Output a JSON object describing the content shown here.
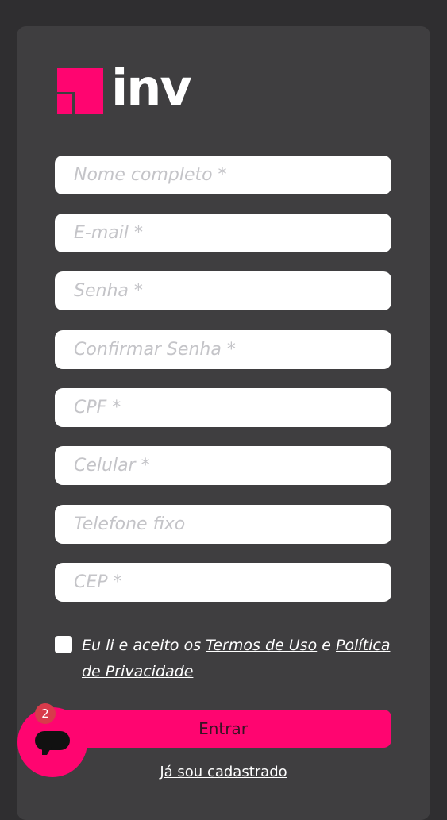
{
  "brand": {
    "name": "inv",
    "accent_color": "#ff0570"
  },
  "form": {
    "fields": [
      {
        "placeholder": "Nome completo *",
        "value": ""
      },
      {
        "placeholder": "E-mail *",
        "value": ""
      },
      {
        "placeholder": "Senha *",
        "value": ""
      },
      {
        "placeholder": "Confirmar Senha *",
        "value": ""
      },
      {
        "placeholder": "CPF *",
        "value": ""
      },
      {
        "placeholder": "Celular *",
        "value": ""
      },
      {
        "placeholder": "Telefone fixo",
        "value": ""
      },
      {
        "placeholder": "CEP *",
        "value": ""
      }
    ],
    "terms": {
      "prefix": "Eu li e aceito os ",
      "terms_link": "Termos de Uso",
      "conjunction": " e ",
      "privacy_link": "Política de Privacidade",
      "checked": false
    },
    "submit_label": "Entrar",
    "login_link": "Já sou cadastrado"
  },
  "chat_widget": {
    "icon": "chat-bubble-icon",
    "badge_count": "2"
  }
}
